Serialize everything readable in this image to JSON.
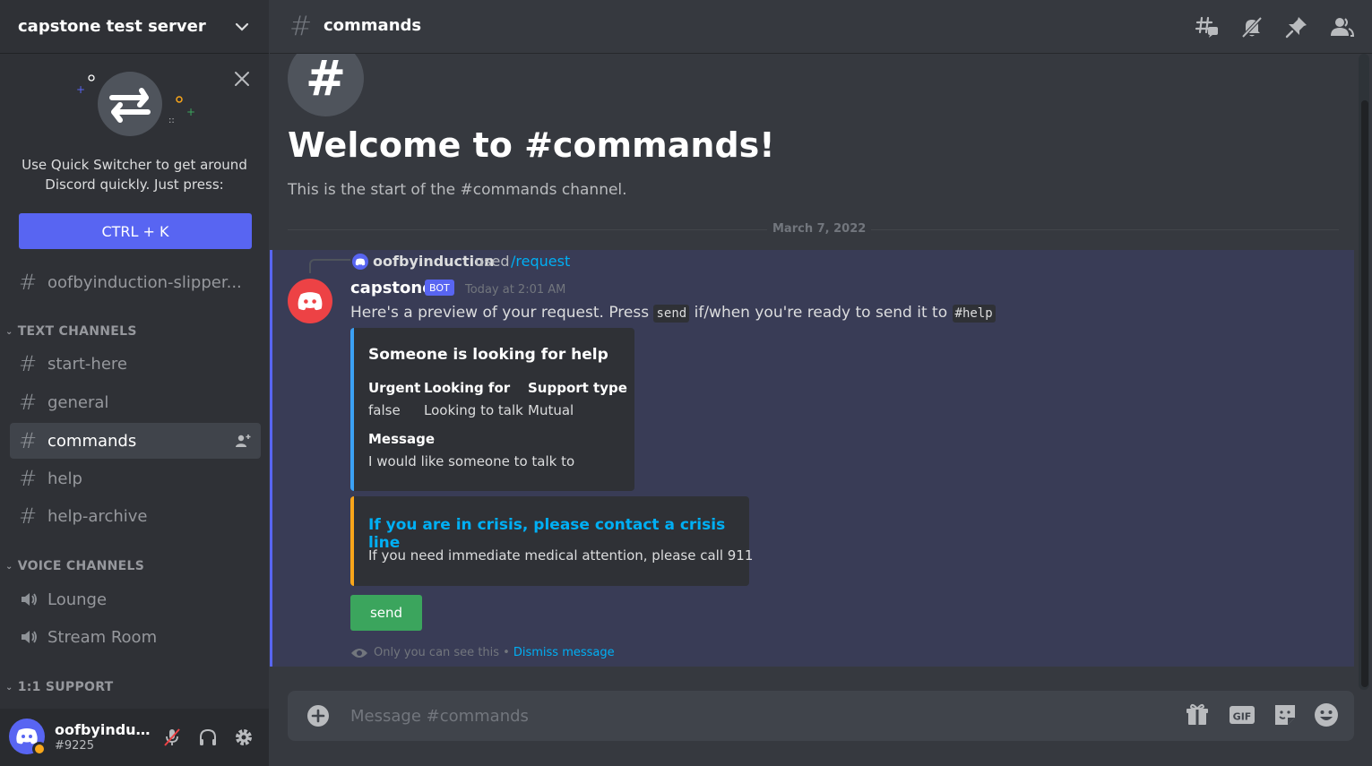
{
  "server": {
    "name": "capstone test server"
  },
  "quick_switcher": {
    "text_line1": "Use Quick Switcher to get around",
    "text_line2": "Discord quickly. Just press:",
    "shortcut": "CTRL + K"
  },
  "sidebar": {
    "pinned_channel": "oofbyinduction-slipper...",
    "categories": {
      "text": "TEXT CHANNELS",
      "voice": "VOICE CHANNELS",
      "support": "1:1 SUPPORT"
    },
    "text_channels": [
      "start-here",
      "general",
      "commands",
      "help",
      "help-archive"
    ],
    "voice_channels": [
      "Lounge",
      "Stream Room"
    ]
  },
  "user": {
    "name": "oofbyinduct...",
    "tag": "#9225"
  },
  "channel": {
    "name": "commands",
    "welcome_title": "Welcome to #commands!",
    "welcome_sub": "This is the start of the #commands channel.",
    "date_divider": "March 7, 2022"
  },
  "message": {
    "reply_user": "oofbyinduction",
    "reply_used": "used",
    "reply_command": "/request",
    "author": "capstone",
    "bot_tag": "BOT",
    "time": "Today at 2:01 AM",
    "text_before": "Here's a preview of your request. Press ",
    "code_send": "send",
    "text_middle": " if/when you're ready to send it to ",
    "code_help": "#help",
    "embed1": {
      "title": "Someone is looking for help",
      "fields": [
        {
          "name": "Urgent",
          "value": "false"
        },
        {
          "name": "Looking for",
          "value": "Looking to talk"
        },
        {
          "name": "Support type",
          "value": "Mutual"
        }
      ],
      "message_name": "Message",
      "message_value": "I would like someone to talk to"
    },
    "embed2": {
      "title": "If you are in crisis, please contact a crisis line",
      "description": "If you need immediate medical attention, please call 911"
    },
    "button": "send",
    "ephemeral_note": "Only you can see this •",
    "dismiss": "Dismiss message"
  },
  "composer": {
    "placeholder": "Message #commands"
  },
  "colors": {
    "blurple": "#5865f2",
    "green": "#3ba55d",
    "red": "#ed4245",
    "embed_blue": "#3ba1f5",
    "embed_orange": "#faa61a",
    "link": "#00aff4"
  }
}
